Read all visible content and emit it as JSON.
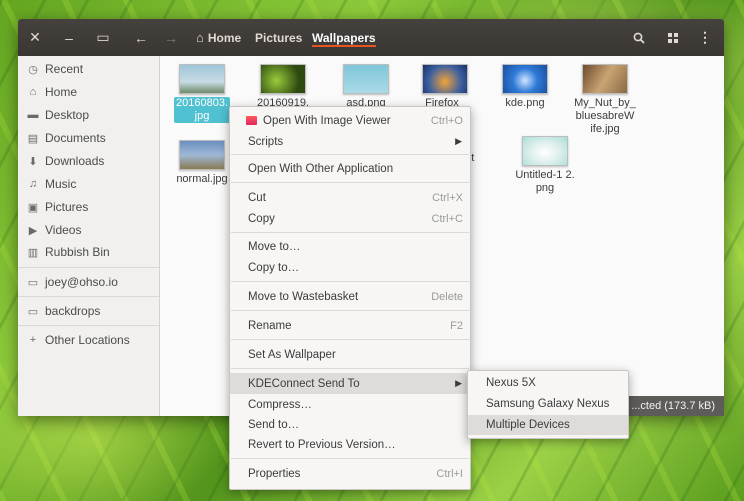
{
  "header": {
    "close": "✕",
    "minimize": "–",
    "maximize": "▭",
    "back": "←",
    "forward": "→",
    "breadcrumbs": [
      "Home",
      "Pictures",
      "Wallpapers"
    ],
    "home_icon": "⌂",
    "search_icon": "search-icon",
    "view_icon": "grid-icon",
    "menu_icon": "⋮"
  },
  "sidebar": {
    "items": [
      {
        "label": "Recent",
        "icon": "🕓"
      },
      {
        "label": "Home",
        "icon": "⌂"
      },
      {
        "label": "Desktop",
        "icon": "▬"
      },
      {
        "label": "Documents",
        "icon": "▤"
      },
      {
        "label": "Downloads",
        "icon": "⬇"
      },
      {
        "label": "Music",
        "icon": "♫"
      },
      {
        "label": "Pictures",
        "icon": "▣"
      },
      {
        "label": "Videos",
        "icon": "▶"
      },
      {
        "label": "Rubbish Bin",
        "icon": "🗑"
      },
      {
        "label": "joey@ohso.io",
        "icon": "▭"
      },
      {
        "label": "backdrops",
        "icon": "▭"
      },
      {
        "label": "Other Locations",
        "icon": "+"
      }
    ]
  },
  "files": [
    {
      "name": "20160803.\njpg"
    },
    {
      "name": "20160919.\n..."
    },
    {
      "name": "asd.png"
    },
    {
      "name": "Firefox_\n...r."
    },
    {
      "name": "kde.png"
    },
    {
      "name": "My_Nut_by_\nbluesabreW\nife.jpg"
    },
    {
      "name": "normal.jpg"
    },
    {
      "name": "...ot\n6-\n4-"
    },
    {
      "name": "Untitled-1 2.\npng"
    }
  ],
  "status": {
    "text": "...cted (173.7 kB)"
  },
  "context_menu": {
    "items": [
      {
        "label": "Open With Image Viewer",
        "accel": "Ctrl+O"
      },
      {
        "label": "Scripts",
        "accel": "▶"
      },
      {
        "label": "Open With Other Application",
        "accel": ""
      },
      {
        "label": "Cut",
        "accel": "Ctrl+X"
      },
      {
        "label": "Copy",
        "accel": "Ctrl+C"
      },
      {
        "label": "Move to…",
        "accel": ""
      },
      {
        "label": "Copy to…",
        "accel": ""
      },
      {
        "label": "Move to Wastebasket",
        "accel": "Delete"
      },
      {
        "label": "Rename",
        "accel": "F2"
      },
      {
        "label": "Set As Wallpaper",
        "accel": ""
      },
      {
        "label": "KDEConnect Send To",
        "accel": "▶"
      },
      {
        "label": "Compress…",
        "accel": ""
      },
      {
        "label": "Send to…",
        "accel": ""
      },
      {
        "label": "Revert to Previous Version…",
        "accel": ""
      },
      {
        "label": "Properties",
        "accel": "Ctrl+I"
      }
    ]
  },
  "submenu": {
    "items": [
      {
        "label": "Nexus 5X"
      },
      {
        "label": "Samsung Galaxy Nexus"
      },
      {
        "label": "Multiple Devices"
      }
    ]
  }
}
